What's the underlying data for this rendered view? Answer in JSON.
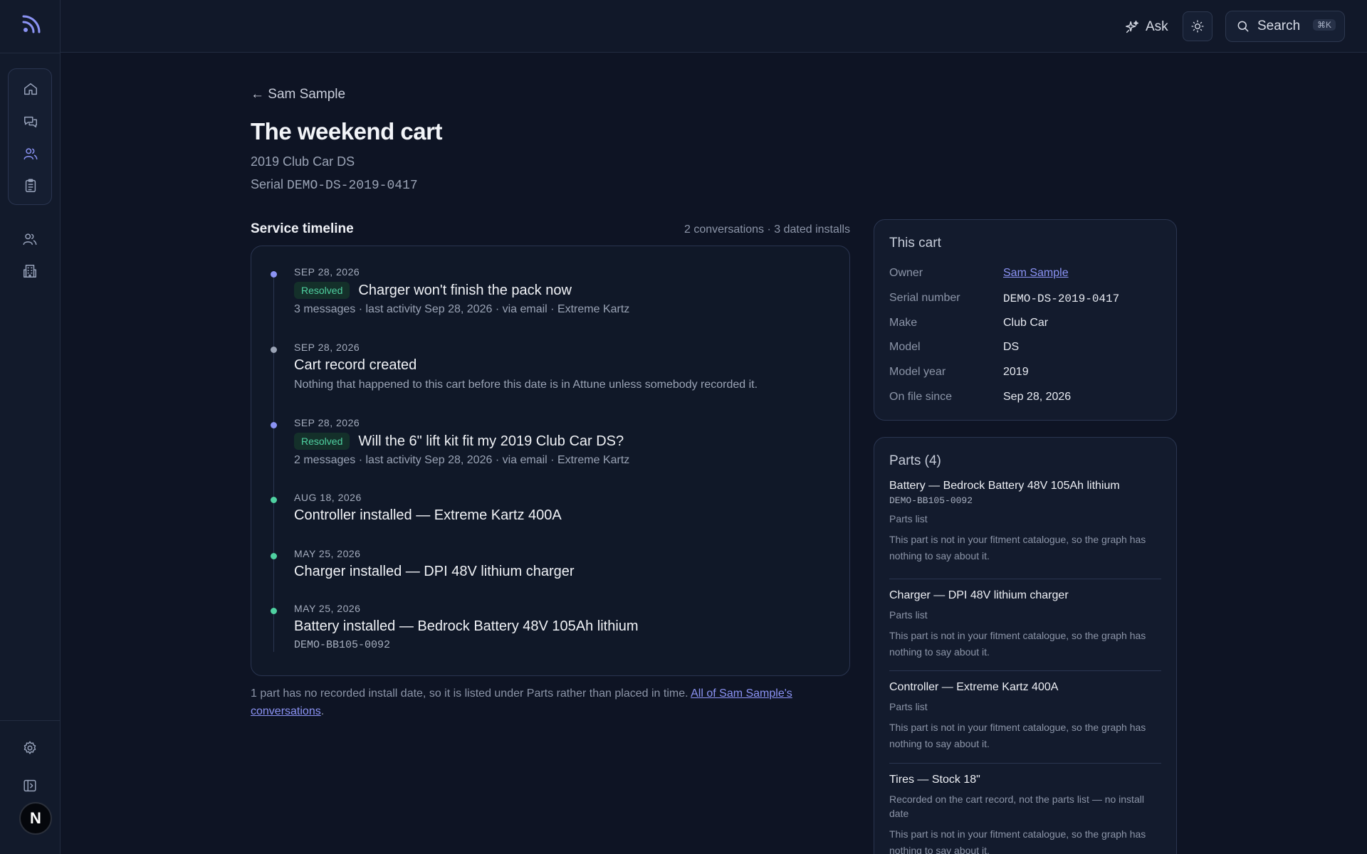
{
  "sidebar": {
    "logo_icon": "rss-feed-icon",
    "nav": [
      {
        "icon": "home-icon"
      },
      {
        "icon": "chat-icon"
      },
      {
        "icon": "customers-icon"
      },
      {
        "icon": "clipboard-icon"
      }
    ],
    "extra": [
      {
        "icon": "team-icon"
      },
      {
        "icon": "building-icon"
      }
    ],
    "settings_icon": "gear-icon",
    "collapse_icon": "sidebar-toggle-icon",
    "avatar_initial": "N"
  },
  "topbar": {
    "ask_label": "Ask",
    "search_label": "Search",
    "search_shortcut": "⌘K"
  },
  "page": {
    "back_arrow": "←",
    "back_label": "Sam Sample",
    "title": "The weekend cart",
    "subtitle": "2019 Club Car DS",
    "serial_prefix": "Serial",
    "serial": "DEMO-DS-2019-0417"
  },
  "timeline": {
    "heading": "Service timeline",
    "meta": "2 conversations · 3 dated installs",
    "items": [
      {
        "date": "SEP 28, 2026",
        "badge": "Resolved",
        "title": "Charger won't finish the pack now",
        "sub": "3 messages · last activity Sep 28, 2026 · via email · Extreme Kartz",
        "dot": "#8b93f4"
      },
      {
        "date": "SEP 28, 2026",
        "title": "Cart record created",
        "sub": "Nothing that happened to this cart before this date is in Attune unless somebody recorded it.",
        "dot": "#9aa3b5"
      },
      {
        "date": "SEP 28, 2026",
        "badge": "Resolved",
        "title": "Will the 6\" lift kit fit my 2019 Club Car DS?",
        "sub": "2 messages · last activity Sep 28, 2026 · via email · Extreme Kartz",
        "dot": "#8b93f4"
      },
      {
        "date": "AUG 18, 2026",
        "title": "Controller installed — Extreme Kartz 400A",
        "dot": "#4fd1a1"
      },
      {
        "date": "MAY 25, 2026",
        "title": "Charger installed — DPI 48V lithium charger",
        "dot": "#4fd1a1"
      },
      {
        "date": "MAY 25, 2026",
        "title": "Battery installed — Bedrock Battery 48V 105Ah lithium",
        "serial": "DEMO-BB105-0092",
        "dot": "#4fd1a1"
      }
    ],
    "footnote_text": "1 part has no recorded install date, so it is listed under Parts rather than placed in time. ",
    "footnote_link": "All of Sam Sample's conversations",
    "footnote_end": "."
  },
  "cart_card": {
    "title": "This cart",
    "rows": [
      {
        "label": "Owner",
        "value": "Sam Sample",
        "link": true
      },
      {
        "label": "Serial number",
        "value": "DEMO-DS-2019-0417",
        "mono": true
      },
      {
        "label": "Make",
        "value": "Club Car"
      },
      {
        "label": "Model",
        "value": "DS"
      },
      {
        "label": "Model year",
        "value": "2019"
      },
      {
        "label": "On file since",
        "value": "Sep 28, 2026"
      }
    ]
  },
  "parts_card": {
    "title": "Parts (4)",
    "items": [
      {
        "name": "Battery — Bedrock Battery 48V 105Ah lithium",
        "serial": "DEMO-BB105-0092",
        "source": "Parts list",
        "note": "This part is not in your fitment catalogue, so the graph has nothing to say about it."
      },
      {
        "name": "Charger — DPI 48V lithium charger",
        "source": "Parts list",
        "note": "This part is not in your fitment catalogue, so the graph has nothing to say about it."
      },
      {
        "name": "Controller — Extreme Kartz 400A",
        "source": "Parts list",
        "note": "This part is not in your fitment catalogue, so the graph has nothing to say about it."
      },
      {
        "name": "Tires — Stock 18\"",
        "source": "Recorded on the cart record, not the parts list — no install date",
        "note": "This part is not in your fitment catalogue, so the graph has nothing to say about it."
      }
    ]
  },
  "colors": {
    "background": "#0e1424",
    "accent": "#8b93f4",
    "resolved": "#4fd1a1"
  }
}
